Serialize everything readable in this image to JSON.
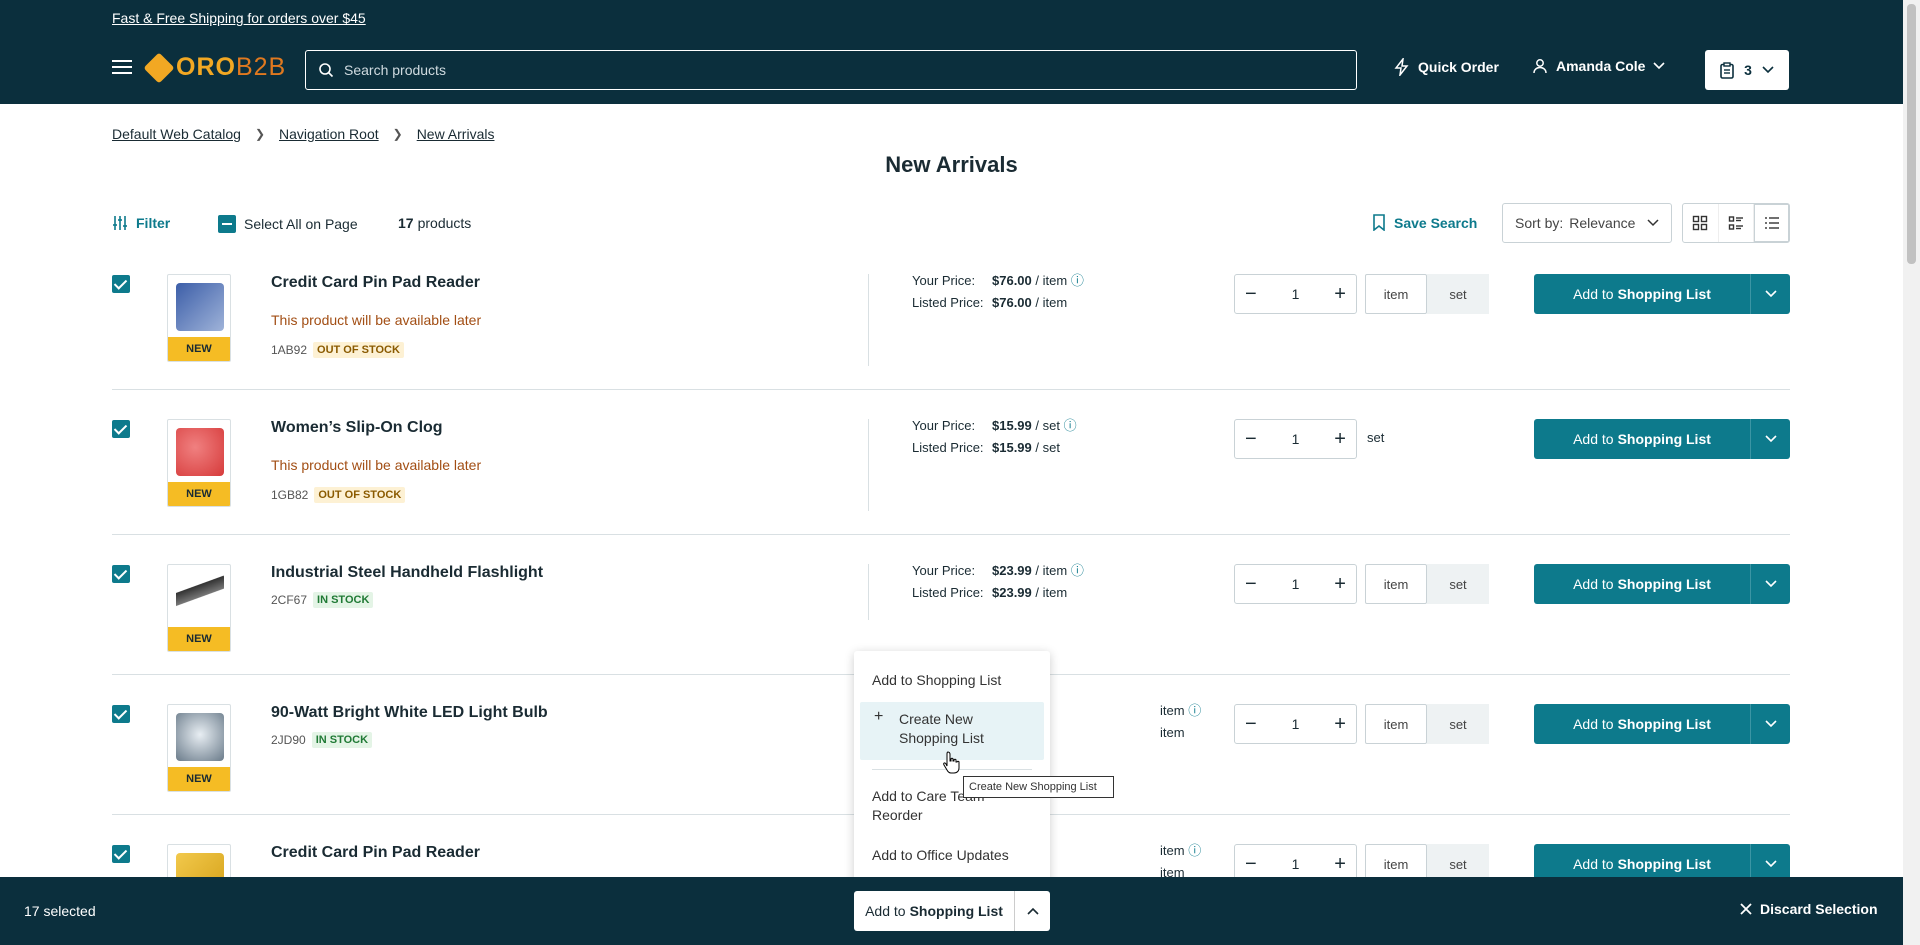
{
  "header": {
    "promo": "Fast & Free Shipping for orders over $45",
    "logo_text_1": "ORO",
    "logo_text_2": "B2B",
    "search_placeholder": "Search products",
    "quick_order": "Quick Order",
    "user_name": "Amanda Cole",
    "cart_count": "3"
  },
  "breadcrumbs": [
    "Default Web Catalog",
    "Navigation Root",
    "New Arrivals"
  ],
  "page_title": "New Arrivals",
  "toolbar": {
    "filter": "Filter",
    "select_all": "Select All on Page",
    "count": "17",
    "count_suffix": "products",
    "save_search": "Save Search",
    "sort_label": "Sort by:",
    "sort_value": "Relevance"
  },
  "products": [
    {
      "name": "Credit Card Pin Pad Reader",
      "availability": "This product will be available later",
      "sku": "1AB92",
      "stock": "OUT OF STOCK",
      "your_price_label": "Your Price:",
      "your_price": "$76.00",
      "your_unit": "/ item",
      "listed_price_label": "Listed Price:",
      "listed_price": "$76.00",
      "listed_unit": "/ item",
      "qty": "1",
      "badge": "NEW",
      "unit_a": "item",
      "unit_b": "set"
    },
    {
      "name": "Women’s Slip-On Clog",
      "availability": "This product will be available later",
      "sku": "1GB82",
      "stock": "OUT OF STOCK",
      "your_price_label": "Your Price:",
      "your_price": "$15.99",
      "your_unit": "/ set",
      "listed_price_label": "Listed Price:",
      "listed_price": "$15.99",
      "listed_unit": "/ set",
      "qty": "1",
      "badge": "NEW",
      "unit_single": "set"
    },
    {
      "name": "Industrial Steel Handheld Flashlight",
      "sku": "2CF67",
      "stock": "IN STOCK",
      "your_price_label": "Your Price:",
      "your_price": "$23.99",
      "your_unit": "/ item",
      "listed_price_label": "Listed Price:",
      "listed_price": "$23.99",
      "listed_unit": "/ item",
      "qty": "1",
      "badge": "NEW",
      "unit_a": "item",
      "unit_b": "set"
    },
    {
      "name": "90-Watt Bright White LED Light Bulb",
      "sku": "2JD90",
      "stock": "IN STOCK",
      "your_unit": "item",
      "listed_unit": "item",
      "qty": "1",
      "badge": "NEW",
      "unit_a": "item",
      "unit_b": "set"
    },
    {
      "name": "Credit Card Pin Pad Reader",
      "your_unit": "item",
      "listed_unit": "item",
      "qty": "1",
      "unit_a": "item",
      "unit_b": "set"
    }
  ],
  "add_button": {
    "prefix": "Add to",
    "bold": "Shopping List"
  },
  "dropdown": {
    "item1": "Add to Shopping List",
    "item2": "Create New Shopping List",
    "item3": "Add to Care Team Reorder",
    "item4": "Add to Office Updates",
    "tooltip": "Create New Shopping List"
  },
  "bottom": {
    "selected": "17 selected",
    "add_prefix": "Add to",
    "add_bold": "Shopping List",
    "discard": "Discard Selection"
  },
  "colors": {
    "header_bg": "#0b2f3d",
    "accent": "#0d7a8c",
    "badge": "#f5bc24"
  }
}
